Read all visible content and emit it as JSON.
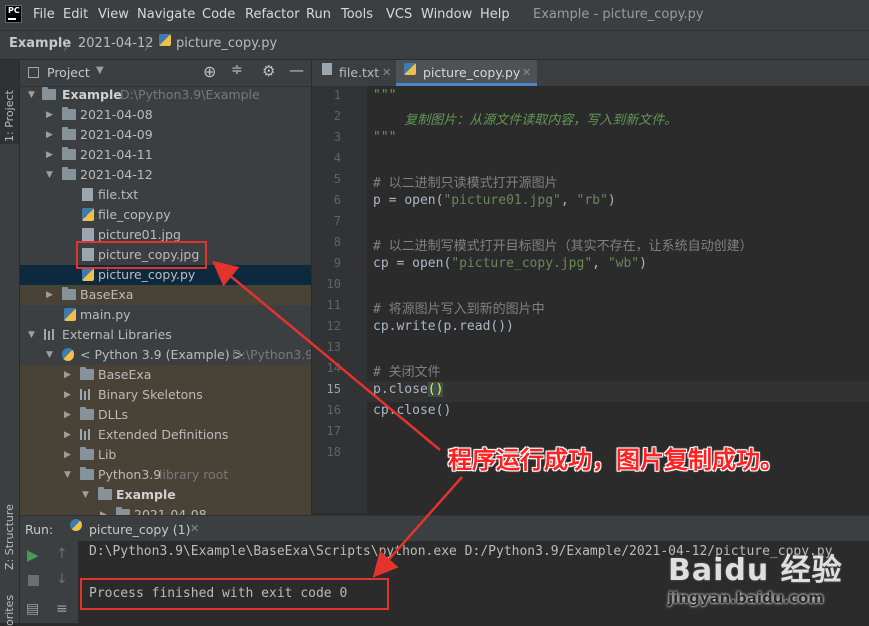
{
  "menubar": {
    "items": [
      "File",
      "Edit",
      "View",
      "Navigate",
      "Code",
      "Refactor",
      "Run",
      "Tools",
      "VCS",
      "Window",
      "Help"
    ],
    "window_title": "Example - picture_copy.py",
    "logo_text": "PC"
  },
  "breadcrumb": [
    "Example",
    "2021-04-12",
    "picture_copy.py"
  ],
  "left_strip": {
    "project_label": "1: Project",
    "structure_label": "Z: Structure",
    "favorites_label": "orites"
  },
  "project_panel": {
    "title": "Project",
    "tree": [
      {
        "label": "Example",
        "path": "D:\\Python3.9\\Example"
      },
      {
        "label": "2021-04-08"
      },
      {
        "label": "2021-04-09"
      },
      {
        "label": "2021-04-11"
      },
      {
        "label": "2021-04-12"
      },
      {
        "label": "file.txt"
      },
      {
        "label": "file_copy.py"
      },
      {
        "label": "picture01.jpg"
      },
      {
        "label": "picture_copy.jpg"
      },
      {
        "label": "picture_copy.py"
      },
      {
        "label": "BaseExa"
      },
      {
        "label": "main.py"
      },
      {
        "label": "External Libraries"
      },
      {
        "label": "< Python 3.9 (Example) >",
        "path": "D:\\Python3.9\\"
      },
      {
        "label": "BaseExa"
      },
      {
        "label": "Binary Skeletons"
      },
      {
        "label": "DLLs"
      },
      {
        "label": "Extended Definitions"
      },
      {
        "label": "Lib"
      },
      {
        "label": "Python3.9",
        "note": "library root"
      },
      {
        "label": "Example"
      },
      {
        "label": "2021-04-08"
      }
    ]
  },
  "editor": {
    "tabs": [
      {
        "label": "file.txt",
        "active": false
      },
      {
        "label": "picture_copy.py",
        "active": true
      }
    ],
    "line_numbers": [
      "1",
      "2",
      "3",
      "4",
      "5",
      "6",
      "7",
      "8",
      "9",
      "10",
      "11",
      "12",
      "13",
      "14",
      "15",
      "16",
      "17",
      "18"
    ],
    "current_line": "15",
    "lines": {
      "l1": "\"\"\"",
      "l2": "    复制图片：从源文件读取内容，写入到新文件。",
      "l3": "\"\"\"",
      "l5": "# 以二进制只读模式打开源图片",
      "l6_a": "p = ",
      "l6_fn": "open",
      "l6_b": "(",
      "l6_s1": "\"picture01.jpg\"",
      "l6_c": ", ",
      "l6_s2": "\"rb\"",
      "l6_d": ")",
      "l8": "# 以二进制写模式打开目标图片（其实不存在，让系统自动创建）",
      "l9_a": "cp = ",
      "l9_fn": "open",
      "l9_b": "(",
      "l9_s1": "\"picture_copy.jpg\"",
      "l9_c": ", ",
      "l9_s2": "\"wb\"",
      "l9_d": ")",
      "l11": "# 将源图片写入到新的图片中",
      "l12": "cp.write(p.read())",
      "l14": "# 关闭文件",
      "l15_a": "p.close",
      "l15_b": "()",
      "l16": "cp.close()"
    }
  },
  "run_panel": {
    "label": "Run:",
    "tab": "picture_copy (1)",
    "command": "D:\\Python3.9\\Example\\BaseExa\\Scripts\\python.exe D:/Python3.9/Example/2021-04-12/picture_copy.py",
    "result": "Process finished with exit code 0"
  },
  "annotation": {
    "text": "程序运行成功，图片复制成功。"
  },
  "watermark": {
    "brand": "Baidu 经验",
    "site": "jingyan.baidu.com"
  },
  "colors": {
    "accent_red": "#e3332d",
    "selection": "#0d293e",
    "run_green": "#499c54"
  }
}
